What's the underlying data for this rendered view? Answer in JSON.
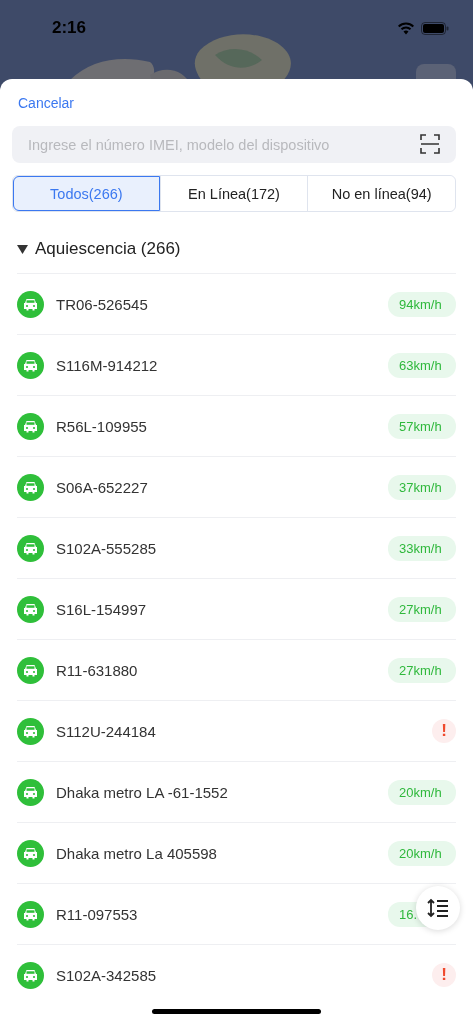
{
  "status_bar": {
    "time": "2:16"
  },
  "cancel": "Cancelar",
  "search": {
    "placeholder": "Ingrese el número IMEI, modelo del dispositivo"
  },
  "tabs": [
    {
      "label": "Todos(266)",
      "selected": true
    },
    {
      "label": "En Línea(172)",
      "selected": false
    },
    {
      "label": "No en línea(94)",
      "selected": false
    }
  ],
  "group": {
    "title": "Aquiescencia (266)",
    "expanded": true
  },
  "devices": [
    {
      "name": "TR06-526545",
      "kind": "speed",
      "speed": "94km/h"
    },
    {
      "name": "S116M-914212",
      "kind": "speed",
      "speed": "63km/h"
    },
    {
      "name": "R56L-109955",
      "kind": "speed",
      "speed": "57km/h"
    },
    {
      "name": "S06A-652227",
      "kind": "speed",
      "speed": "37km/h"
    },
    {
      "name": "S102A-555285",
      "kind": "speed",
      "speed": "33km/h"
    },
    {
      "name": "S16L-154997",
      "kind": "speed",
      "speed": "27km/h"
    },
    {
      "name": "R11-631880",
      "kind": "speed",
      "speed": "27km/h"
    },
    {
      "name": "S112U-244184",
      "kind": "alert",
      "speed": "!"
    },
    {
      "name": "Dhaka metro LA -61-1552",
      "kind": "speed",
      "speed": "20km/h"
    },
    {
      "name": "Dhaka metro La 405598",
      "kind": "speed",
      "speed": "20km/h"
    },
    {
      "name": "R11-097553",
      "kind": "speed",
      "speed": "16."
    },
    {
      "name": "S102A-342585",
      "kind": "alert",
      "speed": "!"
    }
  ]
}
